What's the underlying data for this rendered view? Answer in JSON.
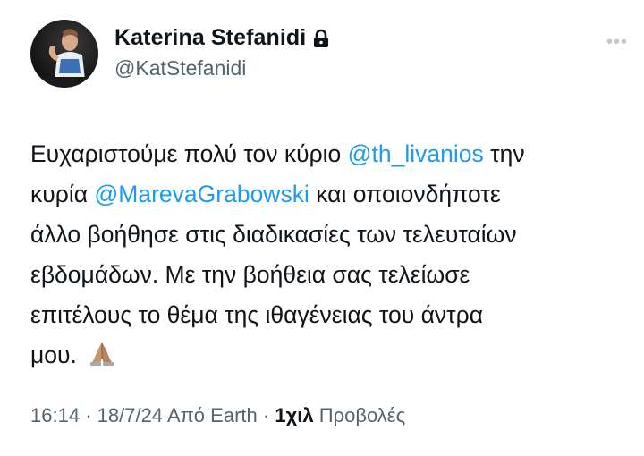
{
  "user": {
    "display_name": "Katerina Stefanidi",
    "handle": "@KatStefanidi",
    "protected_icon": "lock-icon"
  },
  "more_icon": "more-dots-icon",
  "tweet": {
    "lines": [
      [
        {
          "t": "Ευχαριστούμε πολύ τον κύριο "
        },
        {
          "t": "@th_livanios",
          "m": true
        },
        {
          "t": " την"
        }
      ],
      [
        {
          "t": "κυρία "
        },
        {
          "t": "@MarevaGrabowski",
          "m": true
        },
        {
          "t": " και οποιονδήποτε"
        }
      ],
      [
        {
          "t": "άλλο βοήθησε στις διαδικασίες των τελευταίων"
        }
      ],
      [
        {
          "t": "εβδομάδων. Με την βοήθεια σας τελείωσε"
        }
      ],
      [
        {
          "t": "επιτέλους το θέμα της ιθαγένειας του άντρα"
        }
      ],
      [
        {
          "t": "μου. "
        }
      ]
    ],
    "emoji": "praying-hands-icon"
  },
  "meta": {
    "time": "16:14",
    "date": "18/7/24",
    "source": "Από Earth",
    "views_count": "1χιλ",
    "views_label": "Προβολές"
  },
  "colors": {
    "mention": "#1d9bf0",
    "secondary_text": "#536471",
    "primary_text": "#0f1419"
  }
}
